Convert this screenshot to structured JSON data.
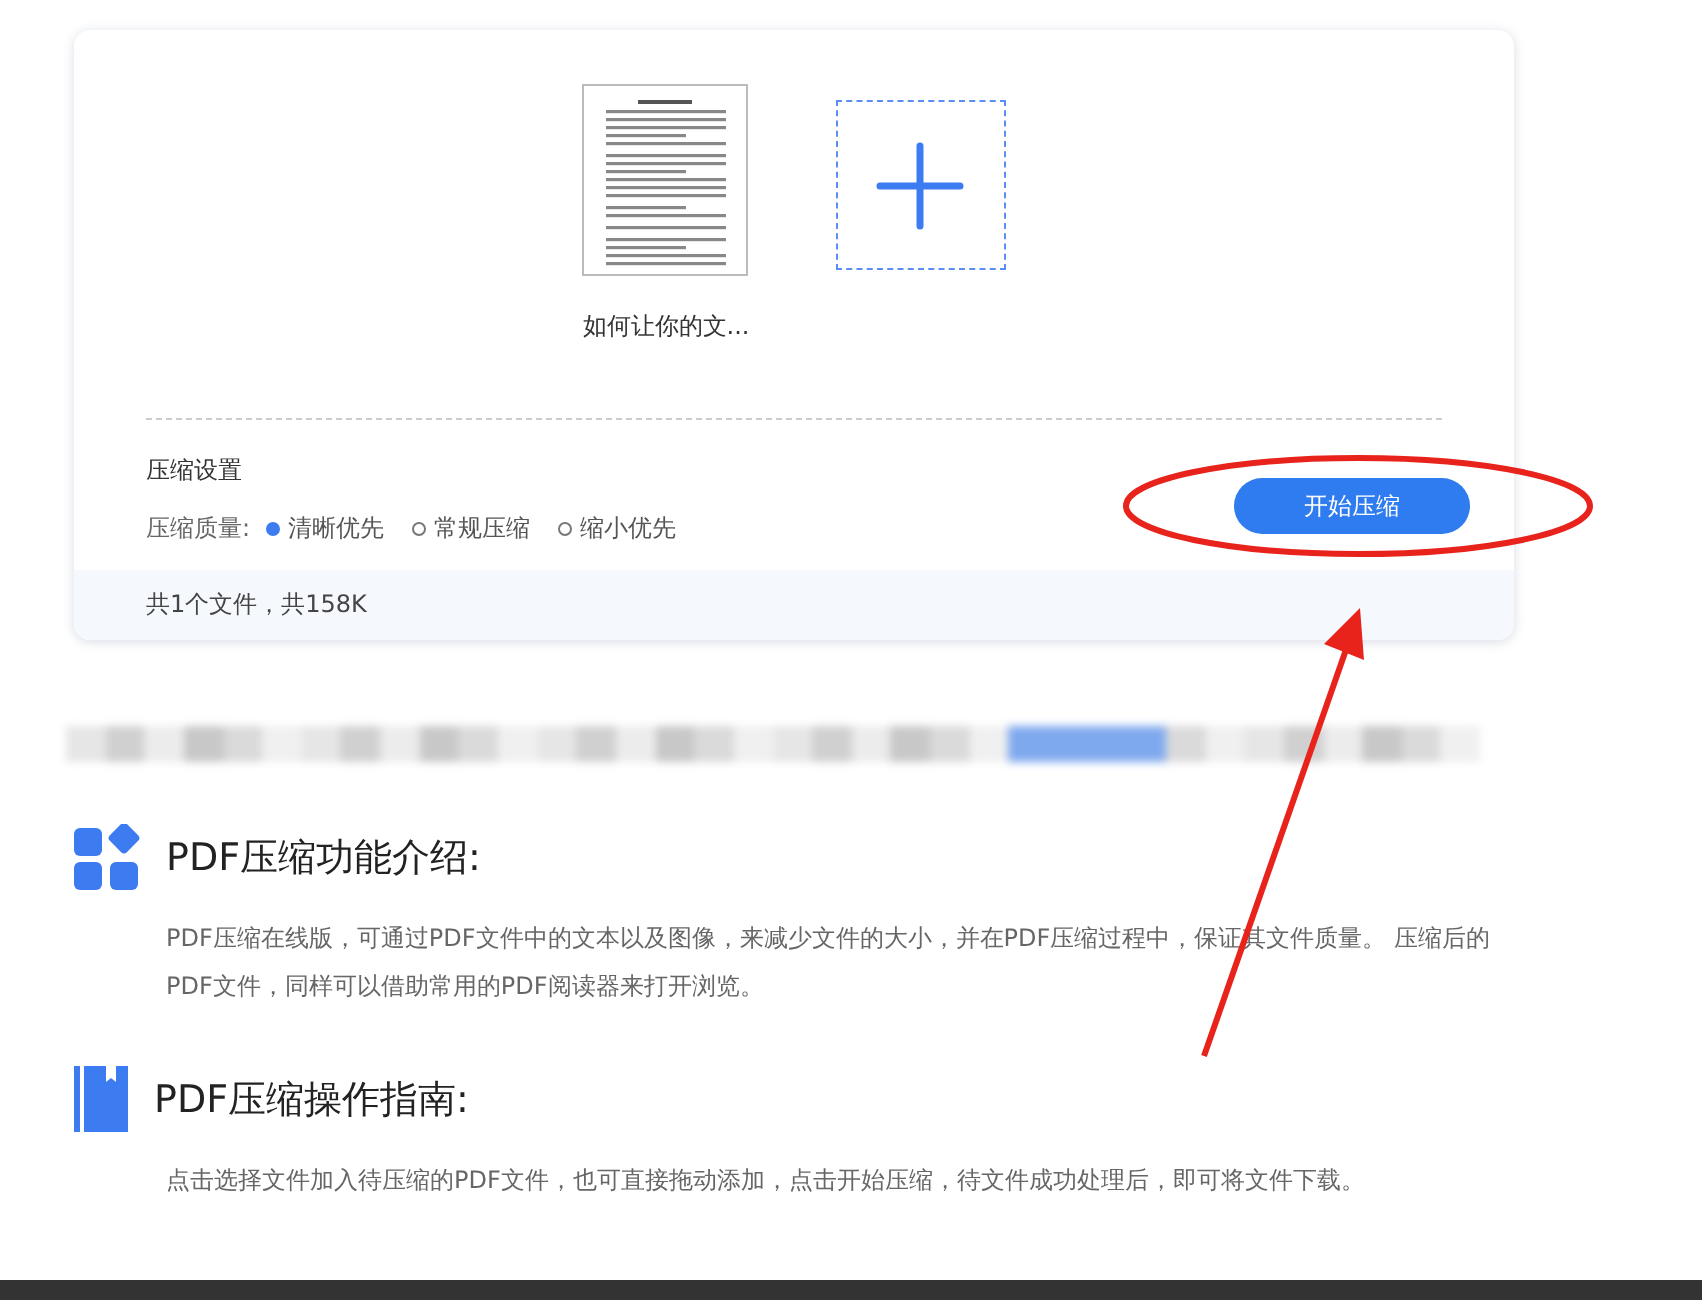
{
  "file": {
    "name": "如何让你的文..."
  },
  "settings": {
    "title": "压缩设置",
    "quality_label": "压缩质量:",
    "options": [
      {
        "label": "清晰优先",
        "selected": true
      },
      {
        "label": "常规压缩",
        "selected": false
      },
      {
        "label": "缩小优先",
        "selected": false
      }
    ],
    "start_button": "开始压缩"
  },
  "summary": "共1个文件，共158K",
  "sections": [
    {
      "kind": "grid",
      "title": "PDF压缩功能介绍:",
      "text": "PDF压缩在线版，可通过PDF文件中的文本以及图像，来减少文件的大小，并在PDF压缩过程中，保证其文件质量。 压缩后的PDF文件，同样可以借助常用的PDF阅读器来打开浏览。"
    },
    {
      "kind": "book",
      "title": "PDF压缩操作指南:",
      "text": "点击选择文件加入待压缩的PDF文件，也可直接拖动添加，点击开始压缩，待文件成功处理后，即可将文件下载。"
    }
  ]
}
